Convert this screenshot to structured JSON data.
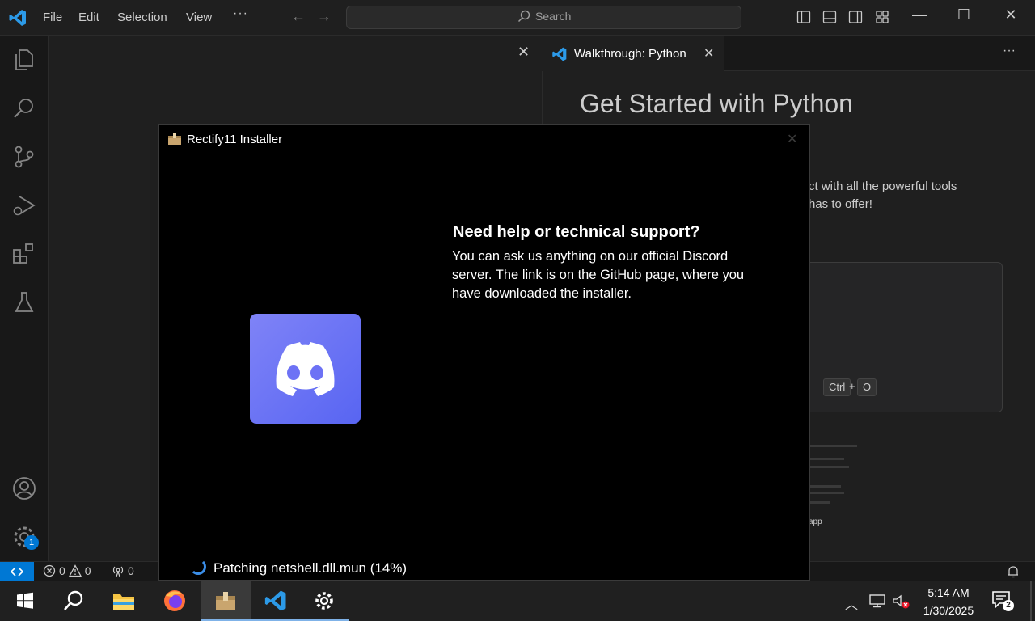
{
  "vscode": {
    "menu": [
      "File",
      "Edit",
      "Selection",
      "View"
    ],
    "more": "···",
    "search_placeholder": "Search",
    "tab_label": "Walkthrough: Python",
    "tab_close": "✕",
    "editor_close": "✕",
    "more_actions": "···",
    "window_controls": {
      "minimize": "—",
      "maximize": "☐",
      "close": "✕"
    },
    "settings_badge": "1",
    "walkthrough": {
      "title": "Get Started with Python",
      "desc_line1": "ct with all the powerful tools",
      "desc_line2": "has to offer!",
      "shortcut_key1": "Ctrl",
      "shortcut_plus": "+",
      "shortcut_key2": "O",
      "thumbnail_label": "app"
    },
    "status": {
      "errors": "0",
      "warnings": "0",
      "ports": "0"
    }
  },
  "installer": {
    "title": "Rectify11 Installer",
    "close": "✕",
    "help_title": "Need help or technical support?",
    "help_text": "You can ask us anything on our official Discord server. The link is on the GitHub page, where you have downloaded the installer.",
    "progress_text": "Patching netshell.dll.mun (14%)",
    "progress_percent": 14
  },
  "taskbar": {
    "time": "5:14 AM",
    "date": "1/30/2025",
    "notification_count": "2",
    "apps": [
      "start",
      "search",
      "file-explorer",
      "firefox",
      "rectify11-installer",
      "vscode",
      "settings"
    ]
  },
  "colors": {
    "vscode_blue": "#0078d4",
    "discord_blurple": "#5865f2",
    "spinner_blue": "#3b8ee8"
  }
}
